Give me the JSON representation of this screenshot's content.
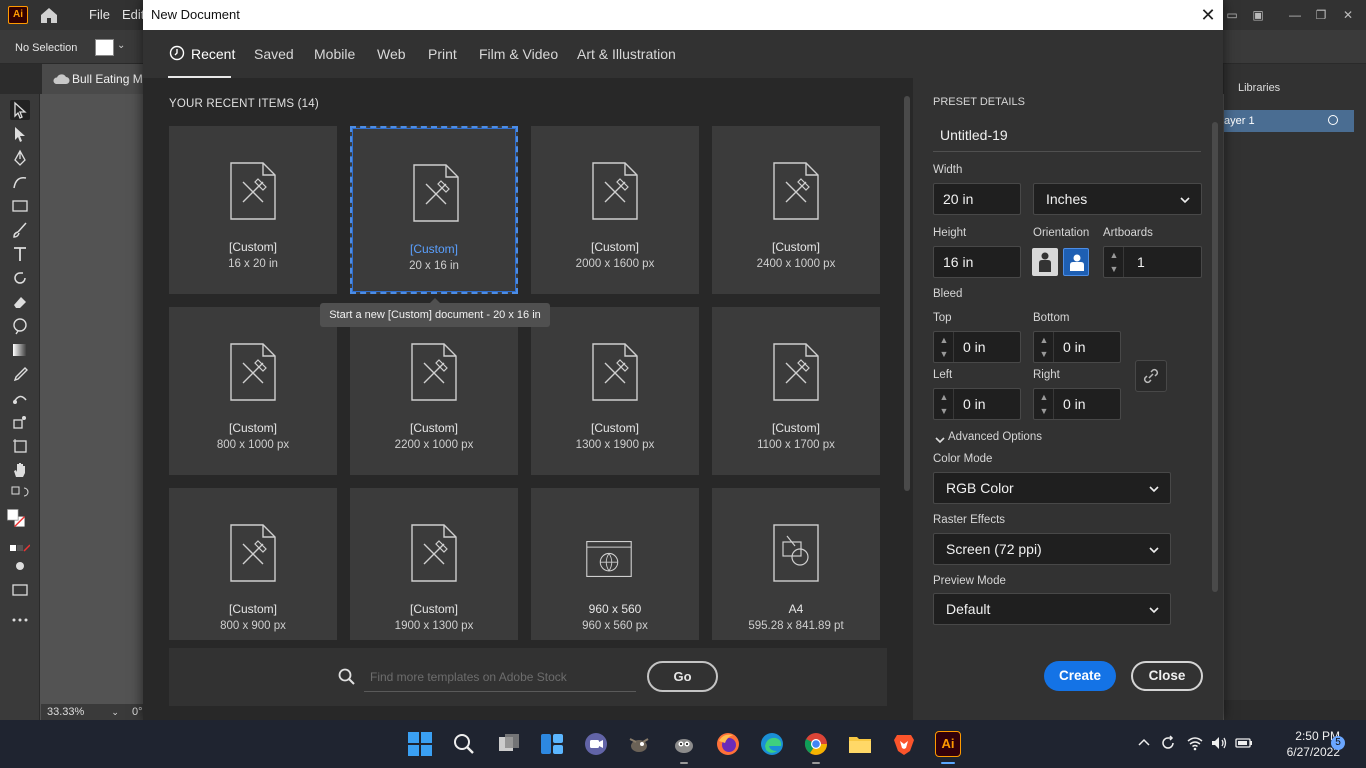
{
  "app": {
    "logo": "Ai",
    "menus": [
      "File",
      "Edit"
    ],
    "no_selection": "No Selection",
    "doc_tab": "Bull Eating M",
    "zoom": "33.33%",
    "rotation": "0°",
    "right_panel_tab": "Libraries",
    "layer_name": "ayer 1"
  },
  "dialog": {
    "title": "New Document",
    "tabs": [
      "Recent",
      "Saved",
      "Mobile",
      "Web",
      "Print",
      "Film & Video",
      "Art & Illustration"
    ],
    "active_tab": "Recent",
    "recent_heading": "YOUR RECENT ITEMS",
    "recent_count": "(14)",
    "items": [
      {
        "name": "[Custom]",
        "size": "16 x 20 in",
        "icon": "document-icon"
      },
      {
        "name": "[Custom]",
        "size": "20 x 16 in",
        "icon": "document-icon",
        "selected": true
      },
      {
        "name": "[Custom]",
        "size": "2000 x 1600 px",
        "icon": "document-icon"
      },
      {
        "name": "[Custom]",
        "size": "2400 x 1000 px",
        "icon": "document-icon"
      },
      {
        "name": "[Custom]",
        "size": "800 x 1000 px",
        "icon": "document-icon"
      },
      {
        "name": "[Custom]",
        "size": "2200 x 1000 px",
        "icon": "document-icon"
      },
      {
        "name": "[Custom]",
        "size": "1300 x 1900 px",
        "icon": "document-icon"
      },
      {
        "name": "[Custom]",
        "size": "1100 x 1700 px",
        "icon": "document-icon"
      },
      {
        "name": "[Custom]",
        "size": "800 x 900 px",
        "icon": "document-icon"
      },
      {
        "name": "[Custom]",
        "size": "1900 x 1300 px",
        "icon": "document-icon"
      },
      {
        "name": "960 x 560",
        "size": "960 x 560 px",
        "icon": "web-icon"
      },
      {
        "name": "A4",
        "size": "595.28 x 841.89 pt",
        "icon": "print-icon"
      }
    ],
    "tooltip": "Start a new [Custom] document - 20 x 16 in",
    "search_placeholder": "Find more templates on Adobe Stock",
    "go_label": "Go",
    "preset": {
      "heading": "PRESET DETAILS",
      "doc_name": "Untitled-19",
      "width_label": "Width",
      "width": "20 in",
      "units": "Inches",
      "height_label": "Height",
      "height": "16 in",
      "orientation_label": "Orientation",
      "orientation": "landscape",
      "artboards_label": "Artboards",
      "artboards": "1",
      "bleed_label": "Bleed",
      "top_label": "Top",
      "top": "0 in",
      "bottom_label": "Bottom",
      "bottom": "0 in",
      "left_label": "Left",
      "left": "0 in",
      "right_label": "Right",
      "right": "0 in",
      "advanced_label": "Advanced Options",
      "color_mode_label": "Color Mode",
      "color_mode": "RGB Color",
      "raster_label": "Raster Effects",
      "raster": "Screen (72 ppi)",
      "preview_label": "Preview Mode",
      "preview": "Default"
    },
    "create_label": "Create",
    "close_label": "Close"
  },
  "taskbar": {
    "time": "2:50 PM",
    "date": "6/27/2022",
    "badge": "5",
    "apps": [
      "windows-start",
      "search",
      "task-view",
      "widgets",
      "teams-chat",
      "gimp",
      "gimp-2",
      "firefox",
      "edge",
      "chrome",
      "file-explorer",
      "brave",
      "illustrator"
    ]
  },
  "colors": {
    "accent": "#1473e6",
    "selection": "#4c8de6",
    "dialog_bg": "#323232",
    "grid_bg": "#282828"
  }
}
